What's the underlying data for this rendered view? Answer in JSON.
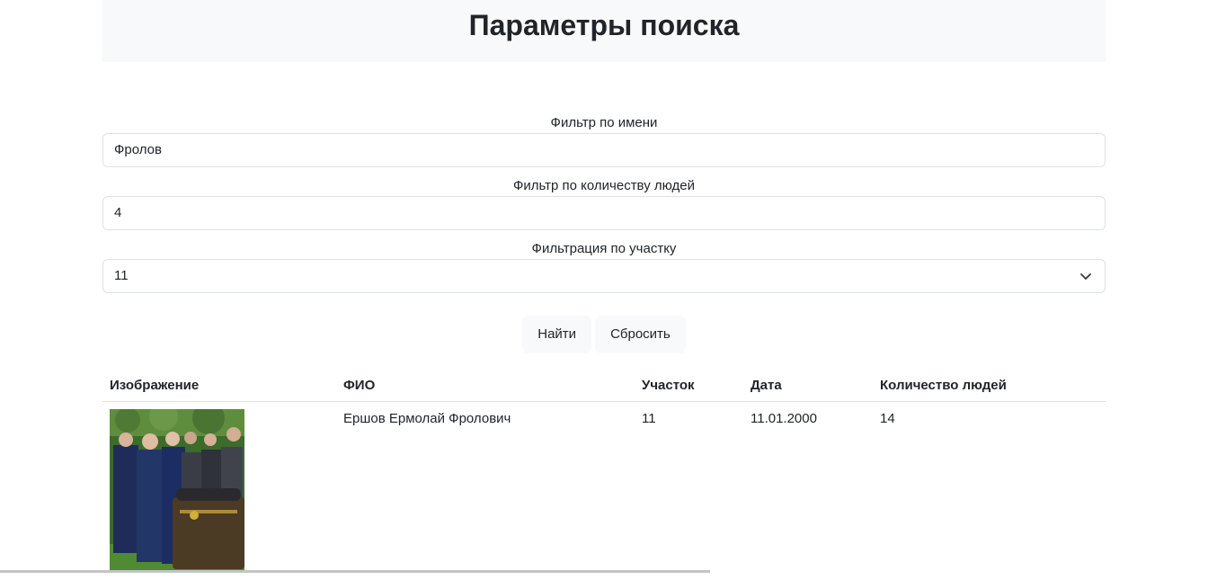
{
  "header": {
    "title": "Параметры поиска"
  },
  "form": {
    "name_filter": {
      "label": "Фильтр по имени",
      "value": "Фролов"
    },
    "people_filter": {
      "label": "Фильтр по количеству людей",
      "value": "4"
    },
    "area_filter": {
      "label": "Фильтрация по участку",
      "selected": "11"
    },
    "find_label": "Найти",
    "reset_label": "Сбросить"
  },
  "table": {
    "headers": [
      "Изображение",
      "ФИО",
      "Участок",
      "Дата",
      "Количество людей"
    ],
    "rows": [
      {
        "image": "funeral-photo",
        "name": "Ершов Ермолай Фролович",
        "area": "11",
        "date": "11.01.2000",
        "people": "14"
      }
    ]
  },
  "colors": {
    "header_bg": "#f8f9fa",
    "border": "#dee2e6",
    "text": "#212529"
  }
}
